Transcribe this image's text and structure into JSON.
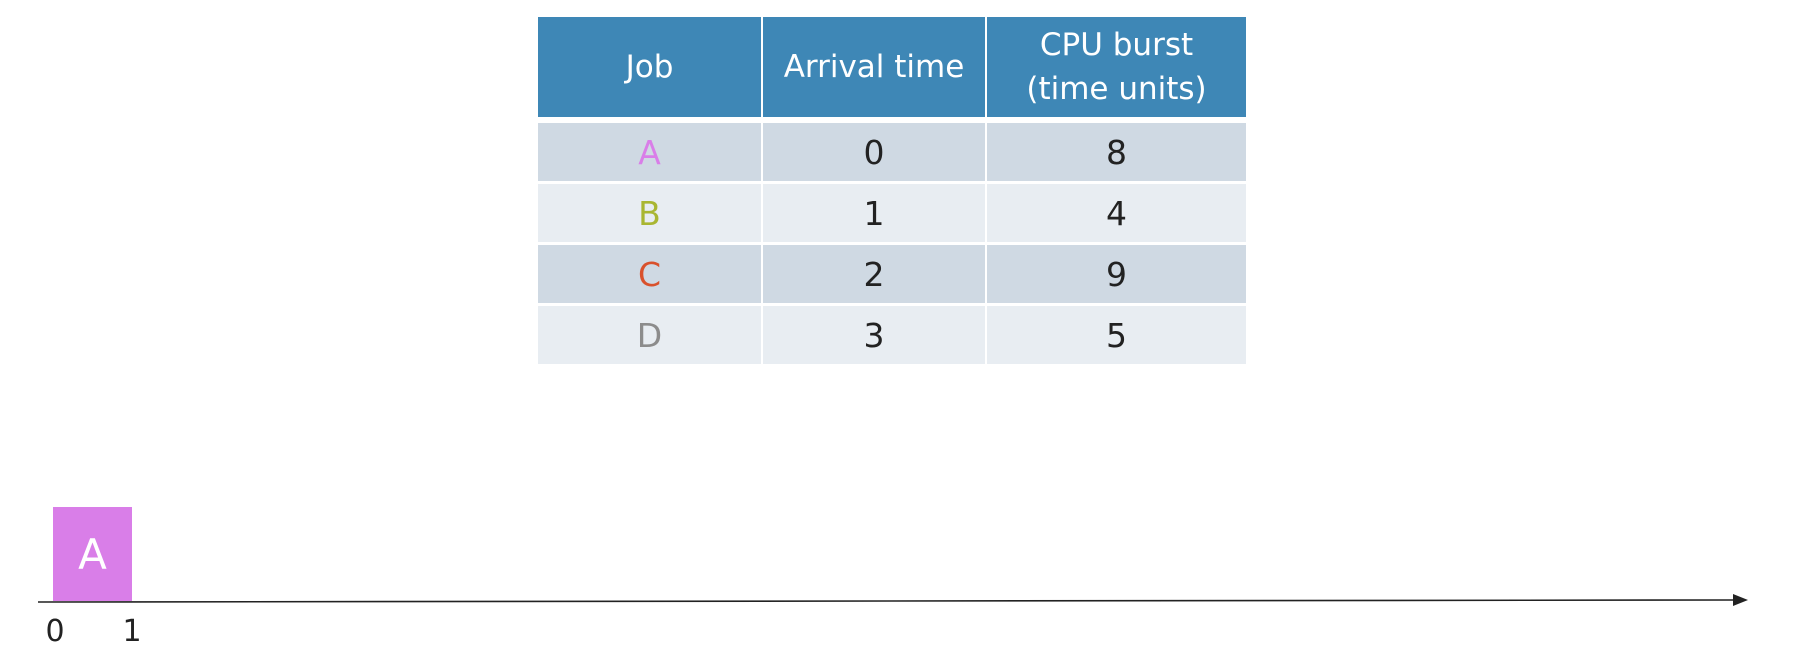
{
  "table": {
    "headers": {
      "job": "Job",
      "arrival": "Arrival time",
      "burst_line1": "CPU burst",
      "burst_line2": "(time units)"
    },
    "rows": [
      {
        "job": "A",
        "arrival": "0",
        "burst": "8",
        "color": "#d97ee8"
      },
      {
        "job": "B",
        "arrival": "1",
        "burst": "4",
        "color": "#a9b632"
      },
      {
        "job": "C",
        "arrival": "2",
        "burst": "9",
        "color": "#d9512c"
      },
      {
        "job": "D",
        "arrival": "3",
        "burst": "5",
        "color": "#8c8c8c"
      }
    ],
    "colors": {
      "header_bg": "#3e87b6",
      "row_dark": "#cfd9e3",
      "row_light": "#e8edf2"
    }
  },
  "timeline": {
    "ticks": [
      "0",
      "1"
    ],
    "blocks": [
      {
        "label": "A",
        "start": 0,
        "end": 1,
        "color": "#d97ee8"
      }
    ]
  }
}
